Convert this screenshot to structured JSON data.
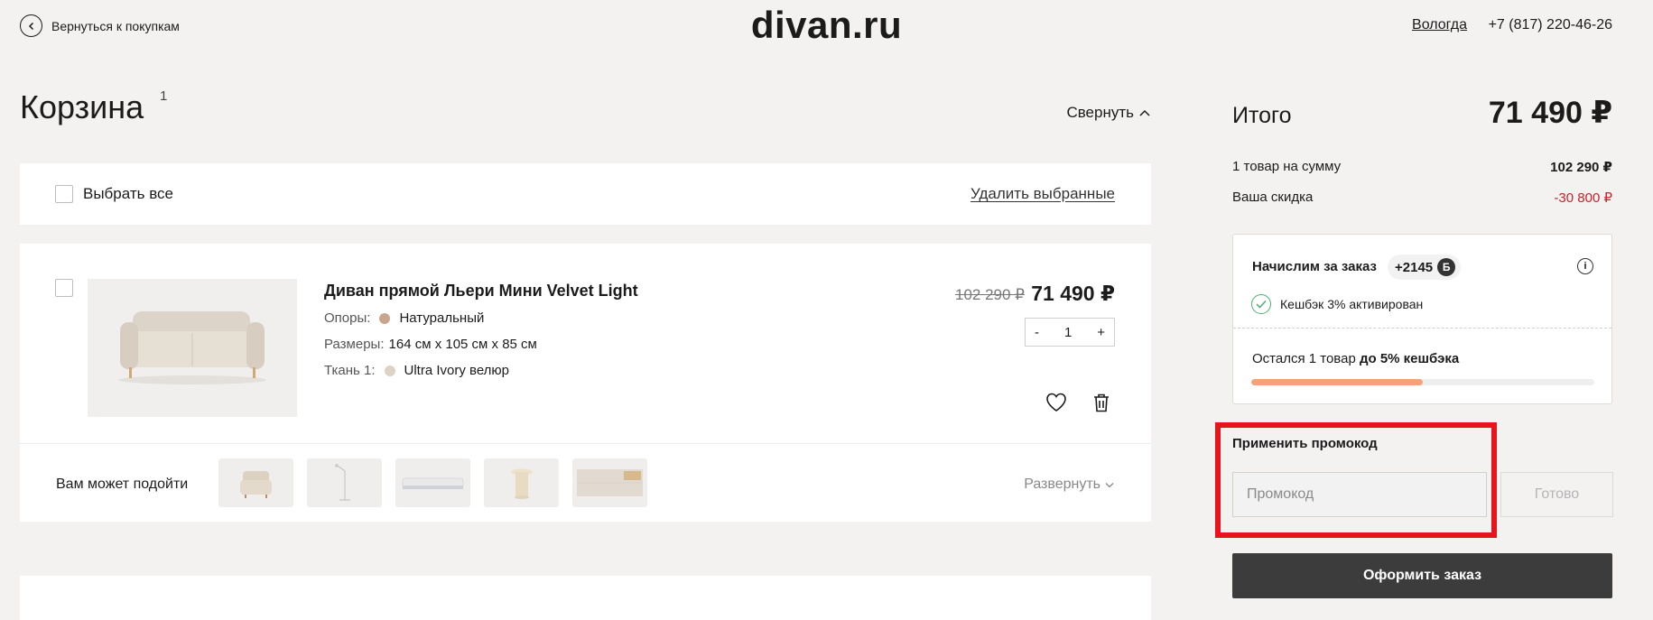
{
  "header": {
    "back_label": "Вернуться к покупкам",
    "logo": "divan.ru",
    "city": "Вологда",
    "phone": "+7 (817) 220-46-26"
  },
  "cart": {
    "title": "Корзина",
    "count": "1",
    "collapse_label": "Свернуть",
    "select_all_label": "Выбрать все",
    "delete_selected_label": "Удалить выбранные",
    "item": {
      "name": "Диван прямой Льери Мини Velvet Light",
      "attributes": [
        {
          "key": "Опоры:",
          "value": "Натуральный",
          "swatch": "#c9a58c"
        },
        {
          "key": "Размеры:",
          "value": "164 см x 105 см x 85 см"
        },
        {
          "key": "Ткань 1:",
          "value": "Ultra Ivory велюр",
          "swatch": "#ddd3c4"
        }
      ],
      "old_price": "102 290 ₽",
      "price": "71 490 ₽",
      "quantity": "1",
      "minus": "-",
      "plus": "+"
    },
    "recommend": {
      "label": "Вам может подойти",
      "expand_label": "Развернуть",
      "thumbnails": [
        "armchair",
        "floor-lamp",
        "mattress",
        "side-table",
        "tv-stand"
      ]
    }
  },
  "summary": {
    "total_label": "Итого",
    "total_value": "71 490 ₽",
    "items_label": "1 товар на сумму",
    "items_value": "102 290 ₽",
    "discount_label": "Ваша скидка",
    "discount_value": "-30 800 ₽",
    "discount_color": "#c8232b",
    "cashback": {
      "title": "Начислим за заказ",
      "points": "+2145",
      "points_badge": "Б",
      "info": "i",
      "active_label": "Кешбэк 3% активирован",
      "remaining_prefix": "Остался 1 товар",
      "remaining_bold": "до 5% кешбэка",
      "progress": 0.5
    },
    "promo": {
      "title": "Применить промокод",
      "placeholder": "Промокод",
      "button": "Готово"
    },
    "order_button": "Оформить заказ"
  }
}
